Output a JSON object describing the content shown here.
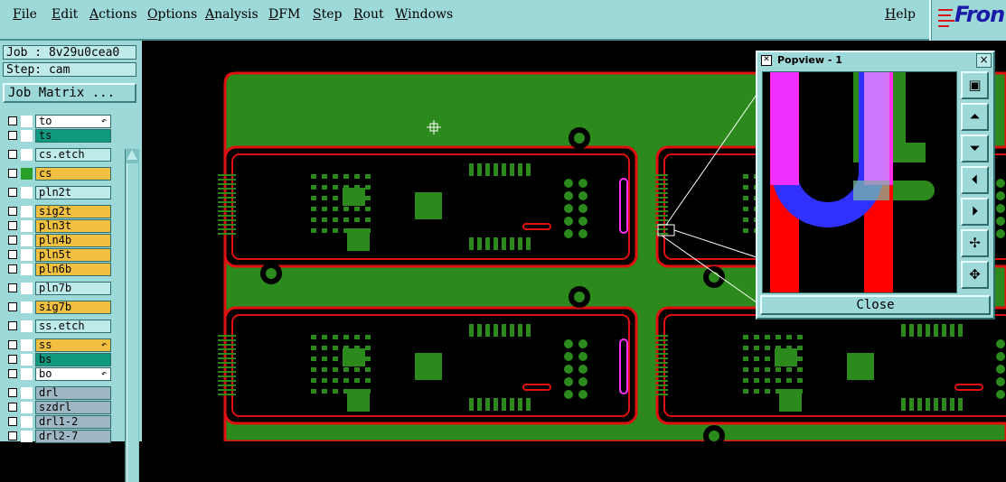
{
  "menubar": {
    "items": [
      "File",
      "Edit",
      "Actions",
      "Options",
      "Analysis",
      "DFM",
      "Step",
      "Rout",
      "Windows"
    ],
    "help": "Help",
    "brand": "Fron"
  },
  "job": {
    "label": "Job : 8v29u0cea0",
    "step": "Step: cam",
    "matrix_button": "Job Matrix ..."
  },
  "layers": [
    {
      "name": "to",
      "color": "#ffffff",
      "swatch": "#ffffff",
      "arrow": true
    },
    {
      "name": "ts",
      "color": "#0f9a80",
      "swatch": "#ffffff",
      "arrow": false
    },
    {
      "name": "cs.etch",
      "color": "#bfeaea",
      "swatch": "#ffffff",
      "arrow": false
    },
    {
      "name": "cs",
      "color": "#f2c040",
      "swatch": "#2aa02a",
      "arrow": false
    },
    {
      "name": "pln2t",
      "color": "#bfeaea",
      "swatch": "#ffffff",
      "arrow": false
    },
    {
      "name": "sig2t",
      "color": "#f2c040",
      "swatch": "#ffffff",
      "arrow": false
    },
    {
      "name": "pln3t",
      "color": "#f2c040",
      "swatch": "#ffffff",
      "arrow": false
    },
    {
      "name": "pln4b",
      "color": "#f2c040",
      "swatch": "#ffffff",
      "arrow": false
    },
    {
      "name": "pln5t",
      "color": "#f2c040",
      "swatch": "#ffffff",
      "arrow": false
    },
    {
      "name": "pln6b",
      "color": "#f2c040",
      "swatch": "#ffffff",
      "arrow": false
    },
    {
      "name": "pln7b",
      "color": "#bfeaea",
      "swatch": "#ffffff",
      "arrow": false
    },
    {
      "name": "sig7b",
      "color": "#f2c040",
      "swatch": "#ffffff",
      "arrow": false
    },
    {
      "name": "ss.etch",
      "color": "#bfeaea",
      "swatch": "#ffffff",
      "arrow": false
    },
    {
      "name": "ss",
      "color": "#f2c040",
      "swatch": "#ffffff",
      "arrow": true
    },
    {
      "name": "bs",
      "color": "#0f9a80",
      "swatch": "#ffffff",
      "arrow": false
    },
    {
      "name": "bo",
      "color": "#ffffff",
      "swatch": "#ffffff",
      "arrow": true
    },
    {
      "name": "drl",
      "color": "#9fb6c4",
      "swatch": "#ffffff",
      "arrow": false
    },
    {
      "name": "szdrl",
      "color": "#9fb6c4",
      "swatch": "#ffffff",
      "arrow": false
    },
    {
      "name": "drl1-2",
      "color": "#9fb6c4",
      "swatch": "#ffffff",
      "arrow": false
    },
    {
      "name": "drl2-7",
      "color": "#9fb6c4",
      "swatch": "#ffffff",
      "arrow": false
    }
  ],
  "popview": {
    "title": "Popview - 1",
    "close_label": "Close",
    "close_x": "×",
    "tools": [
      "zoom-fit-icon",
      "pan-up-icon",
      "pan-down-icon",
      "pan-left-icon",
      "pan-right-icon",
      "zoom-in-icon",
      "zoom-out-icon"
    ]
  },
  "colors": {
    "board": "#2c8a1c",
    "outline": "#e01010",
    "ui": "#9ed9d9",
    "magenta": "#ff30ff",
    "blue": "#3030ff",
    "red": "#ff0000"
  }
}
